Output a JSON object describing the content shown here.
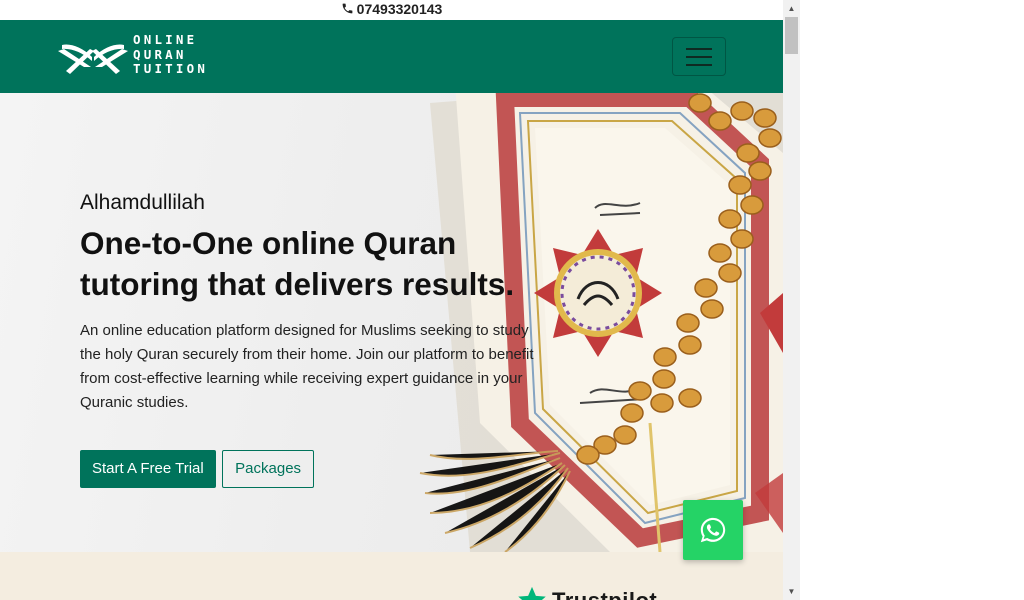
{
  "topbar": {
    "phone": "07493320143",
    "icon": "phone-icon"
  },
  "header": {
    "logo_lines": [
      "ONLINE",
      "QURAN",
      "TUITION"
    ],
    "logo_icon": "open-book-icon",
    "menu_icon": "hamburger-menu-icon"
  },
  "hero": {
    "greeting": "Alhamdullilah",
    "title": "One-to-One online Quran tutoring that delivers results.",
    "description": "An online education platform designed for Muslims seeking to study the holy Quran securely from their home. Join our platform to benefit from cost-effective learning while receiving expert guidance in your Quranic studies.",
    "primary_button": "Start A Free Trial",
    "secondary_button": "Packages"
  },
  "trust": {
    "brand": "Trustpilot",
    "icon": "star-icon"
  },
  "whatsapp": {
    "icon": "whatsapp-icon"
  },
  "colors": {
    "brand_green": "#00735b",
    "whatsapp_green": "#25d366",
    "trust_bg": "#f4ede0",
    "trust_star": "#00b67a"
  }
}
